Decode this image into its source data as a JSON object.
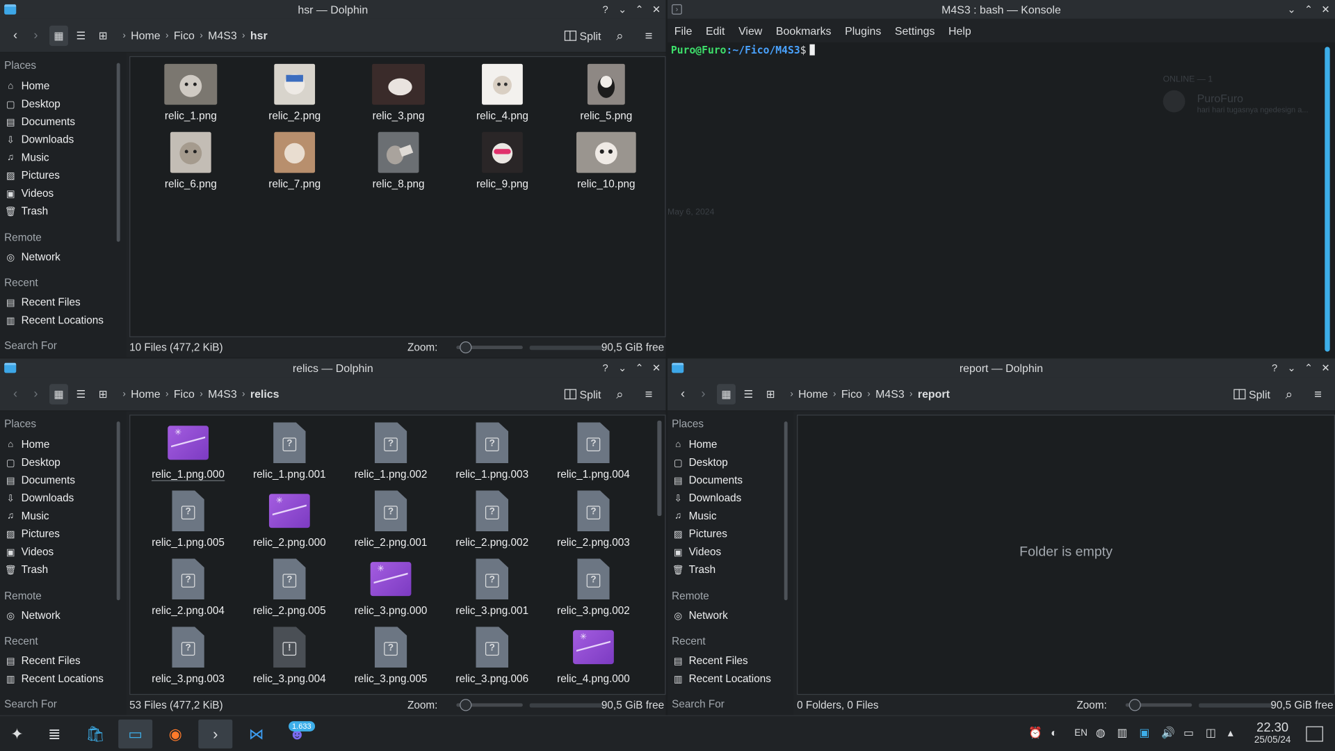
{
  "places_heading": "Places",
  "remote_heading": "Remote",
  "recent_heading": "Recent",
  "search_heading": "Search For",
  "places": [
    "Home",
    "Desktop",
    "Documents",
    "Downloads",
    "Music",
    "Pictures",
    "Videos",
    "Trash"
  ],
  "remote": [
    "Network"
  ],
  "recent": [
    "Recent Files",
    "Recent Locations"
  ],
  "split_label": "Split",
  "zoom_label": "Zoom:",
  "free_space": "90,5 GiB free",
  "win_hsr": {
    "title": "hsr — Dolphin",
    "breadcrumb": [
      "Home",
      "Fico",
      "M4S3",
      "hsr"
    ],
    "files": [
      "relic_1.png",
      "relic_2.png",
      "relic_3.png",
      "relic_4.png",
      "relic_5.png",
      "relic_6.png",
      "relic_7.png",
      "relic_8.png",
      "relic_9.png",
      "relic_10.png"
    ],
    "status": "10 Files (477,2 KiB)"
  },
  "win_relics": {
    "title": "relics — Dolphin",
    "breadcrumb": [
      "Home",
      "Fico",
      "M4S3",
      "relics"
    ],
    "files": [
      "relic_1.png.000",
      "relic_1.png.001",
      "relic_1.png.002",
      "relic_1.png.003",
      "relic_1.png.004",
      "relic_1.png.005",
      "relic_2.png.000",
      "relic_2.png.001",
      "relic_2.png.002",
      "relic_2.png.003",
      "relic_2.png.004",
      "relic_2.png.005",
      "relic_3.png.000",
      "relic_3.png.001",
      "relic_3.png.002",
      "relic_3.png.003",
      "relic_3.png.004",
      "relic_3.png.005",
      "relic_3.png.006",
      "relic_4.png.000"
    ],
    "status": "53 Files (477,2 KiB)"
  },
  "win_report": {
    "title": "report — Dolphin",
    "breadcrumb": [
      "Home",
      "Fico",
      "M4S3",
      "report"
    ],
    "empty_message": "Folder is empty",
    "status": "0 Folders, 0 Files"
  },
  "konsole": {
    "title": "M4S3 : bash — Konsole",
    "menu": [
      "File",
      "Edit",
      "View",
      "Bookmarks",
      "Plugins",
      "Settings",
      "Help"
    ],
    "prompt_user": "Puro@Furo",
    "prompt_path": ":~/Fico/M4S3",
    "prompt_symbol": "$",
    "ghost_online": "ONLINE — 1",
    "ghost_user": "PuroFuro",
    "ghost_status": "hari hari tugasnya ngedesign a...",
    "ghost_date": "May 6, 2024"
  },
  "taskbar": {
    "badge": "1.633",
    "lang": "EN",
    "time": "22.30",
    "date": "25/05/24"
  },
  "colors": {
    "accent": "#3daee9",
    "purple_icon": "#9b59d8"
  }
}
